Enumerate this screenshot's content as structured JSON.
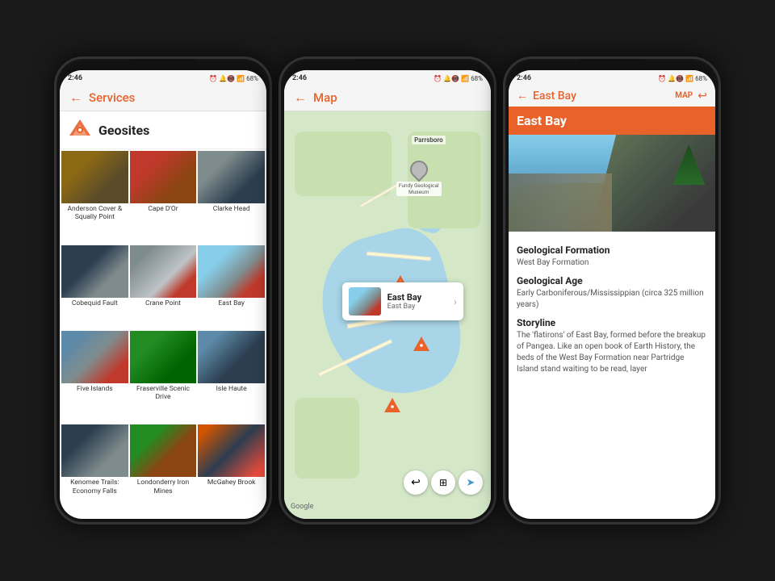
{
  "phone1": {
    "status": {
      "time": "2:46",
      "icons": "⏰ 🔔📵🎵 📶 68%"
    },
    "header": {
      "back": "←",
      "title": "Services"
    },
    "geosites": {
      "label": "Geosites",
      "items": [
        {
          "id": "anderson",
          "label": "Anderson Cover &\nSqually Point",
          "thumb_class": "thumb-anderson"
        },
        {
          "id": "capedor",
          "label": "Cape D'Or",
          "thumb_class": "thumb-capedor"
        },
        {
          "id": "clarkes",
          "label": "Clarke  Head",
          "thumb_class": "thumb-clarkes"
        },
        {
          "id": "cobequid",
          "label": "Cobequid Fault",
          "thumb_class": "thumb-cobequid"
        },
        {
          "id": "crane",
          "label": "Crane Point",
          "thumb_class": "thumb-crane"
        },
        {
          "id": "eastbay",
          "label": "East Bay",
          "thumb_class": "thumb-eastbay"
        },
        {
          "id": "fiveislands",
          "label": "Five Islands",
          "thumb_class": "thumb-fiveislands"
        },
        {
          "id": "fraserville",
          "label": "Fraserville Scenic Drive",
          "thumb_class": "thumb-fraserville"
        },
        {
          "id": "islehaute",
          "label": "Isle Haute",
          "thumb_class": "thumb-islehaute"
        },
        {
          "id": "kenomee",
          "label": "Kenomee Trails:\nEconomy Falls",
          "thumb_class": "thumb-kenomee"
        },
        {
          "id": "londonderry",
          "label": "Londonderry Iron Mines",
          "thumb_class": "thumb-londonderry"
        },
        {
          "id": "mcgahey",
          "label": "McGahey Brook",
          "thumb_class": "thumb-mcgahey"
        }
      ]
    }
  },
  "phone2": {
    "status": {
      "time": "2:46",
      "icons": "⏰ 🔔📵🎵 📶 68%"
    },
    "header": {
      "back": "←",
      "title": "Map"
    },
    "map": {
      "museum_label": "Fundy Geological\nMuseum",
      "parrsboro_label": "Parrsboro",
      "popup_title": "East Bay",
      "popup_sub": "East Bay",
      "google_label": "Google"
    },
    "controls": {
      "undo": "↩",
      "layers": "⊞",
      "location": "➤"
    }
  },
  "phone3": {
    "status": {
      "time": "2:46",
      "icons": "⏰ 🔔📵🎵 📶 68%"
    },
    "header": {
      "back": "←",
      "title": "East Bay",
      "map_label": "MAP",
      "return_icon": "↩"
    },
    "banner": "East Bay",
    "sections": [
      {
        "title": "Geological Formation",
        "text": "West Bay Formation"
      },
      {
        "title": "Geological Age",
        "text": "Early Carboniferous/Mississippian (circa 325 million years)"
      },
      {
        "title": "Storyline",
        "text": "The 'flatirons' of East Bay, formed before the breakup of Pangea. Like an open book of Earth History, the beds of the West Bay Formation near Partridge Island stand waiting to be read, layer"
      }
    ]
  }
}
